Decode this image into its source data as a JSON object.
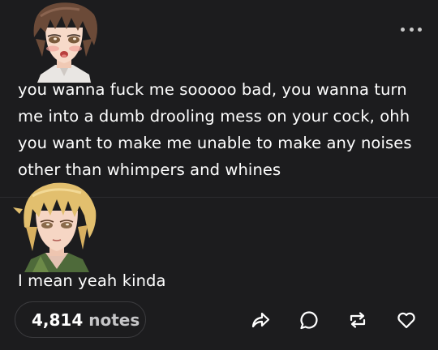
{
  "post": {
    "more_icon": "more-horizontal-icon",
    "messages": [
      {
        "avatar": "anime-avatar-brown-hair",
        "text": "you wanna fuck me sooooo bad, you wanna turn me into a dumb drooling mess on your cock, ohh you want to make me unable to make any noises other than whimpers and whines"
      },
      {
        "avatar": "anime-avatar-blonde-hair",
        "text": "I mean yeah kinda"
      }
    ],
    "footer": {
      "notes_count": "4,814",
      "notes_label": "notes",
      "actions": [
        "share-icon",
        "reply-icon",
        "reblog-icon",
        "like-icon"
      ]
    }
  },
  "colors": {
    "background": "#1c1c1e",
    "text": "#ffffff",
    "muted": "#c6c6c8",
    "border": "#3b3b3e"
  }
}
